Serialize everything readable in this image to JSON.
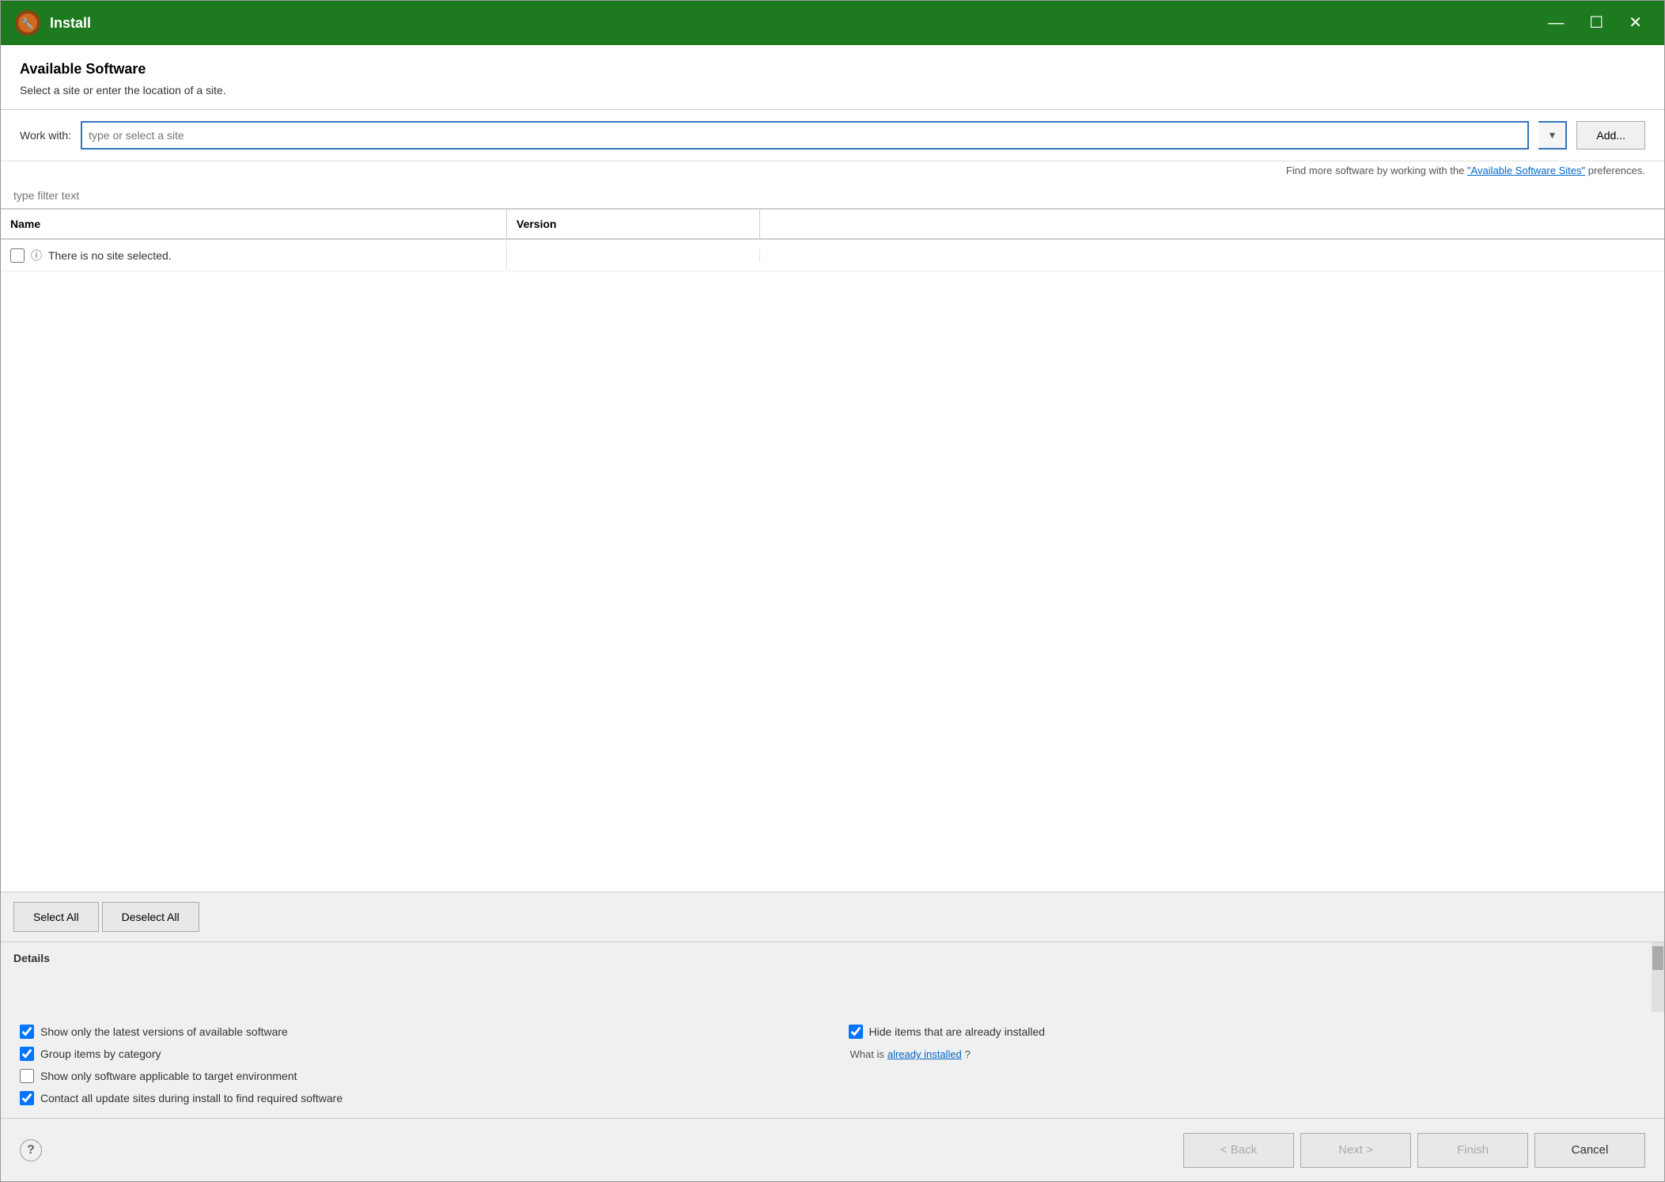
{
  "window": {
    "title": "Install",
    "minimize_label": "—",
    "maximize_label": "☐",
    "close_label": "✕"
  },
  "header": {
    "title": "Available Software",
    "subtitle": "Select a site or enter the location of a site."
  },
  "work_with": {
    "label": "Work with:",
    "placeholder": "type or select a site",
    "add_button": "Add..."
  },
  "more_software": {
    "text_before": "Find more software by working with the ",
    "link_text": "\"Available Software Sites\"",
    "text_after": " preferences."
  },
  "filter": {
    "placeholder": "type filter text"
  },
  "table": {
    "col_name": "Name",
    "col_version": "Version",
    "items": [
      {
        "name": "There is no site selected.",
        "version": "",
        "checked": false
      }
    ]
  },
  "buttons": {
    "select_all": "Select All",
    "deselect_all": "Deselect All"
  },
  "details": {
    "label": "Details"
  },
  "checkboxes": [
    {
      "id": "cb1",
      "label": "Show only the latest versions of available software",
      "checked": true
    },
    {
      "id": "cb2",
      "label": "Group items by category",
      "checked": true
    },
    {
      "id": "cb3",
      "label": "Show only software applicable to target environment",
      "checked": false
    },
    {
      "id": "cb4",
      "label": "Contact all update sites during install to find required software",
      "checked": true
    },
    {
      "id": "cb5",
      "label": "Hide items that are already installed",
      "checked": true
    }
  ],
  "what_is": {
    "text_before": "What is ",
    "link_text": "already installed",
    "text_after": "?"
  },
  "footer": {
    "help_label": "?",
    "back_button": "< Back",
    "next_button": "Next >",
    "finish_button": "Finish",
    "cancel_button": "Cancel"
  }
}
